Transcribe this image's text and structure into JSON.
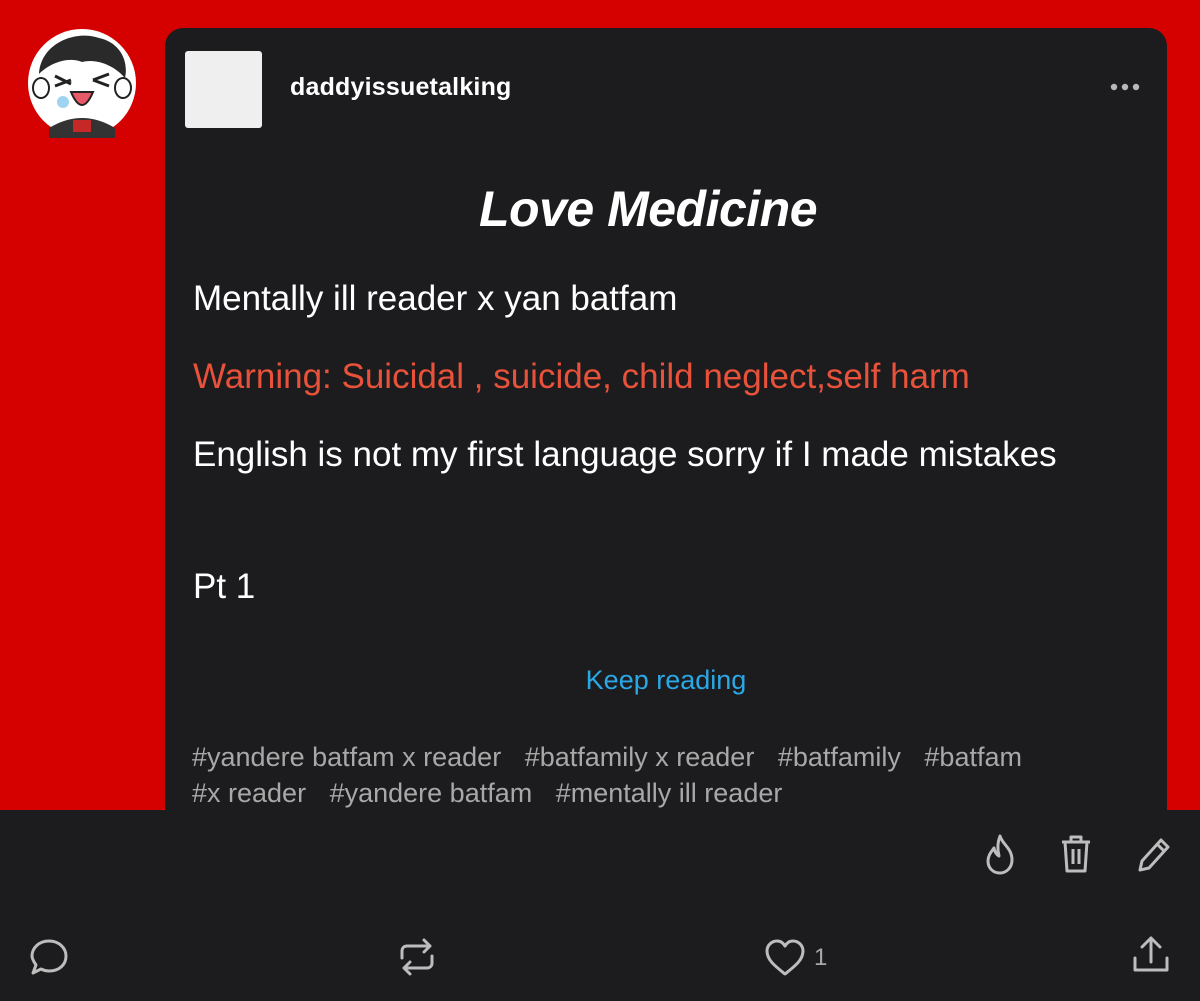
{
  "post": {
    "blog_name": "daddyissuetalking",
    "title": "Love Medicine",
    "subtitle": "Mentally ill reader x yan batfam",
    "warning": "Warning: Suicidal , suicide, child neglect,self harm",
    "note": "English is not my first language sorry if I made mistakes",
    "part": "Pt 1",
    "keep_reading": "Keep reading",
    "tags": [
      "#yandere batfam x reader",
      "#batfamily x reader",
      "#batfamily",
      "#batfam",
      "#x reader",
      "#yandere batfam",
      "#mentally ill reader"
    ]
  },
  "footer": {
    "like_count": "1"
  },
  "icons": {
    "menu": "more-horizontal-icon",
    "actions": [
      "blaze-flame-icon",
      "trash-icon",
      "edit-pencil-icon"
    ],
    "bar": [
      "comment-icon",
      "reblog-icon",
      "heart-icon",
      "share-icon"
    ]
  },
  "colors": {
    "background": "#d50000",
    "card": "#1c1c1e",
    "warning": "#e8513a",
    "link": "#2aa8e6",
    "tag": "#a8a8a8"
  }
}
